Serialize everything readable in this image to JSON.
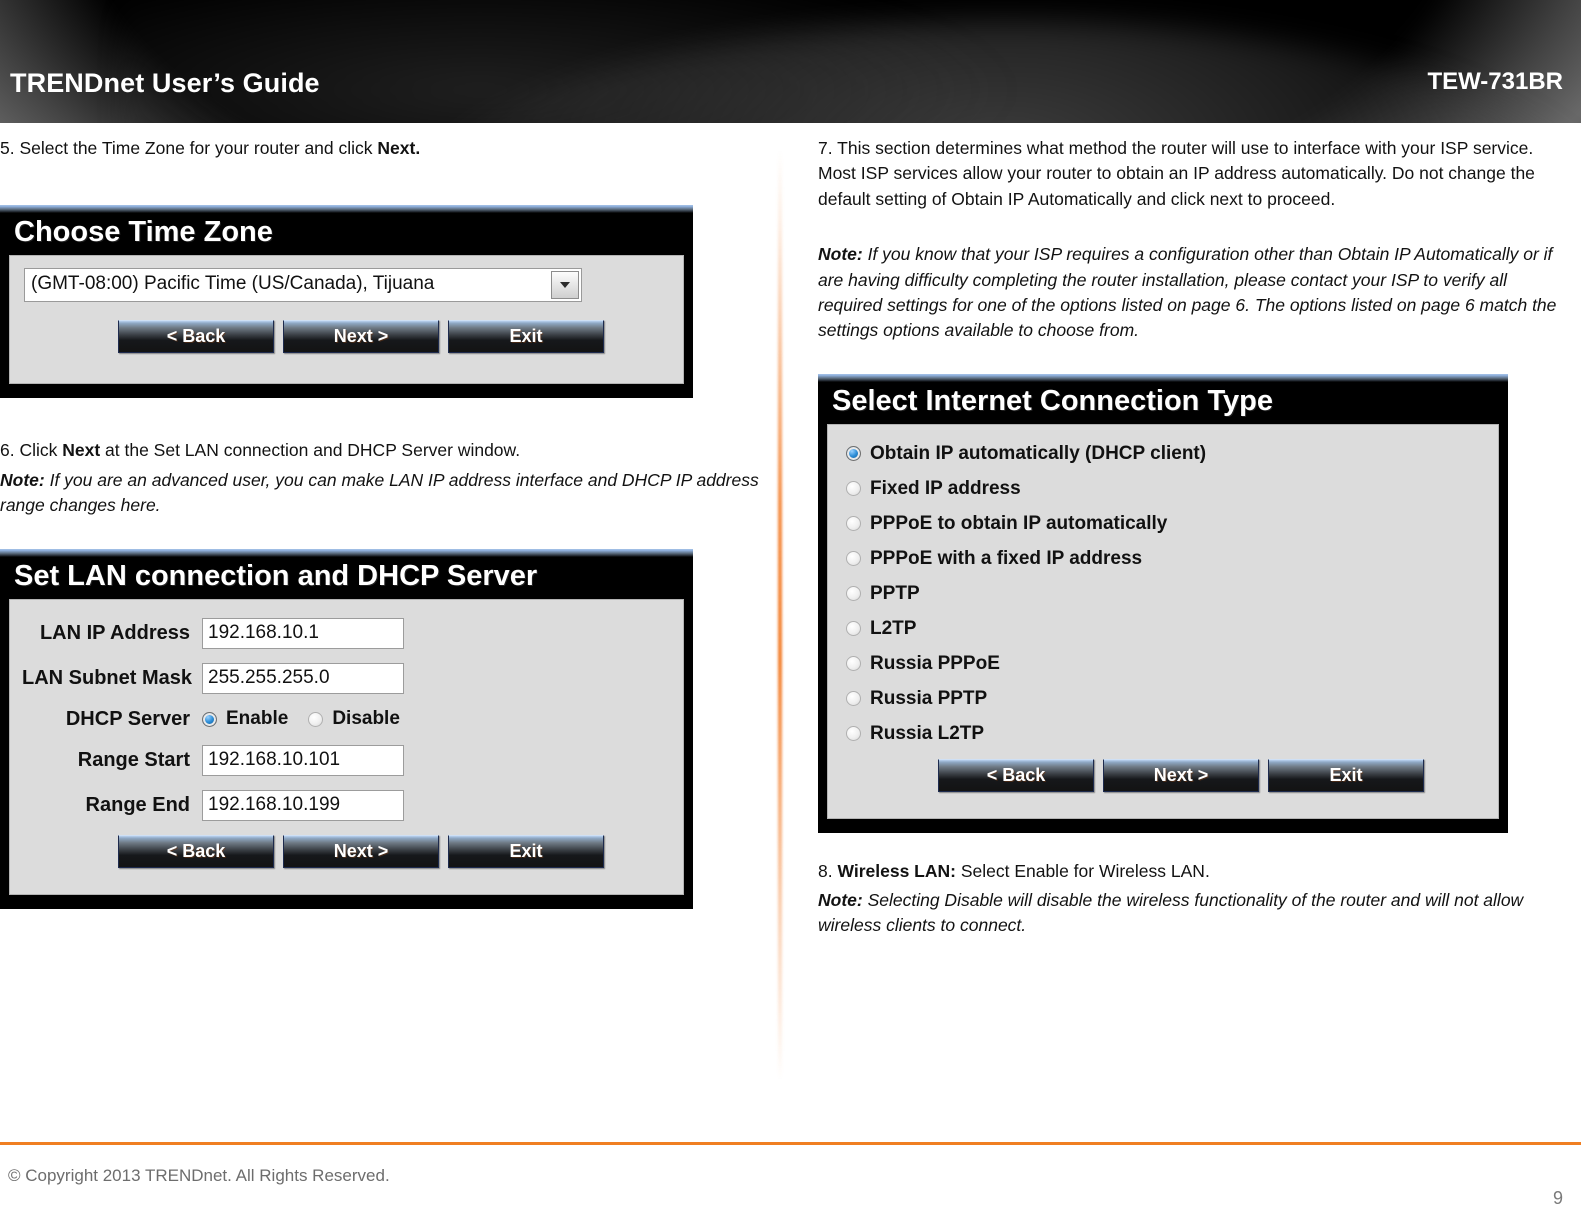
{
  "header": {
    "title": "TRENDnet User’s Guide",
    "model": "TEW-731BR"
  },
  "left_column": {
    "step5": {
      "prefix": "5. Select the Time Zone for your router and click ",
      "bold": "Next."
    },
    "step6": {
      "prefix": "6. Click ",
      "bold": "Next",
      "suffix": " at the Set LAN connection and DHCP Server window."
    },
    "step6_note": {
      "label": "Note:",
      "text": " If you are an advanced user, you can make LAN IP address interface and DHCP IP address range changes here."
    }
  },
  "right_column": {
    "step7": {
      "text": "7. This section determines what method the router will use to interface with your ISP service. Most ISP services allow your router to obtain an IP address automatically. Do not change the default setting of Obtain IP Automatically and click next to proceed."
    },
    "step7_note": {
      "label": "Note:",
      "text": " If you know that your ISP requires a configuration other than Obtain IP Automatically or if are having difficulty completing the router installation, please contact your ISP to verify all required settings for one of the options listed on page 6. The options listed on page 6 match the settings options available to choose from."
    },
    "step8": {
      "prefix": "8. ",
      "bold": "Wireless LAN:",
      "suffix": " Select Enable for Wireless LAN."
    },
    "step8_note": {
      "label": "Note:",
      "text": " Selecting Disable will disable the wireless functionality of the router and will not allow wireless clients to connect."
    }
  },
  "dialog_timezone": {
    "title": "Choose Time Zone",
    "selected_timezone": "(GMT-08:00) Pacific Time (US/Canada), Tijuana",
    "buttons": {
      "back": "< Back",
      "next": "Next >",
      "exit": "Exit"
    }
  },
  "dialog_lan": {
    "title": "Set LAN connection and DHCP Server",
    "fields": [
      {
        "label": "LAN IP Address",
        "value": "192.168.10.1"
      },
      {
        "label": "LAN Subnet Mask",
        "value": "255.255.255.0"
      }
    ],
    "dhcp_server": {
      "label": "DHCP Server",
      "options": [
        {
          "label": "Enable",
          "selected": true
        },
        {
          "label": "Disable",
          "selected": false
        }
      ]
    },
    "range_fields": [
      {
        "label": "Range Start",
        "value": "192.168.10.101"
      },
      {
        "label": "Range End",
        "value": "192.168.10.199"
      }
    ],
    "buttons": {
      "back": "< Back",
      "next": "Next >",
      "exit": "Exit"
    }
  },
  "dialog_wan": {
    "title": "Select Internet Connection Type",
    "options": [
      {
        "label": "Obtain IP automatically (DHCP client)",
        "selected": true
      },
      {
        "label": "Fixed IP address",
        "selected": false
      },
      {
        "label": "PPPoE to obtain IP automatically",
        "selected": false
      },
      {
        "label": "PPPoE with a fixed IP address",
        "selected": false
      },
      {
        "label": "PPTP",
        "selected": false
      },
      {
        "label": "L2TP",
        "selected": false
      },
      {
        "label": "Russia PPPoE",
        "selected": false
      },
      {
        "label": "Russia PPTP",
        "selected": false
      },
      {
        "label": "Russia L2TP",
        "selected": false
      }
    ],
    "buttons": {
      "back": "< Back",
      "next": "Next >",
      "exit": "Exit"
    }
  },
  "footer": {
    "copyright": "© Copyright 2013 TRENDnet. All Rights Reserved.",
    "page_number": "9"
  },
  "colors": {
    "accent_orange": "#f07f22",
    "dialog_body": "#dcdcdc",
    "radio_selected": "#2f8fd8"
  }
}
